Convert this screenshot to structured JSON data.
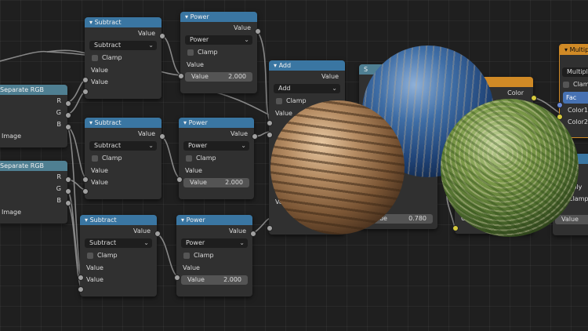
{
  "nodes": {
    "sep1": {
      "title": "Separate RGB",
      "r": "R",
      "g": "G",
      "b": "B",
      "image": "Image"
    },
    "sep2": {
      "title": "Separate RGB",
      "r": "R",
      "g": "G",
      "b": "B",
      "image": "Image"
    },
    "sub1": {
      "title": "Subtract",
      "out": "Value",
      "op": "Subtract",
      "clamp": "Clamp",
      "in1": "Value",
      "in2": "Value"
    },
    "sub2": {
      "title": "Subtract",
      "out": "Value",
      "op": "Subtract",
      "clamp": "Clamp",
      "in1": "Value",
      "in2": "Value"
    },
    "sub3": {
      "title": "Subtract",
      "out": "Value",
      "op": "Subtract",
      "clamp": "Clamp",
      "in1": "Value",
      "in2": "Value"
    },
    "pow1": {
      "title": "Power",
      "out": "Value",
      "op": "Power",
      "clamp": "Clamp",
      "in1": "Value",
      "field_label": "Value",
      "field_value": "2.000"
    },
    "pow2": {
      "title": "Power",
      "out": "Value",
      "op": "Power",
      "clamp": "Clamp",
      "in1": "Value",
      "field_label": "Value",
      "field_value": "2.000"
    },
    "pow3": {
      "title": "Power",
      "out": "Value",
      "op": "Power",
      "clamp": "Clamp",
      "in1": "Value",
      "field_label": "Value",
      "field_value": "2.000"
    },
    "add": {
      "title": "Add",
      "out": "Value",
      "op": "Add",
      "clamp": "Clamp",
      "in1": "Value",
      "in2": "Value"
    },
    "mid": {
      "title": "S",
      "field_label": "Value",
      "field_value": "0.780"
    },
    "mix": {
      "out": "Color",
      "in": "Color"
    },
    "mult": {
      "title": "Multiply",
      "op": "Multiply",
      "clamp": "Clamp",
      "fac": "Fac",
      "color1": "Color1",
      "color2": "Color2"
    },
    "mult2": {
      "op": "tiply",
      "clamp": "Clamp",
      "value": "Value"
    }
  },
  "colors": {
    "header_blue": "#3a76a2",
    "header_teal": "#4f7f92",
    "header_orange": "#d08a26",
    "socket_grey": "#a1a1a1",
    "socket_yellow": "#d6c93c"
  }
}
